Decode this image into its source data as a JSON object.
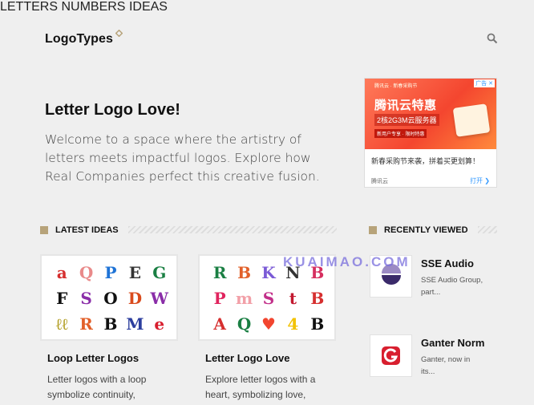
{
  "header": {
    "logo": "LogoTypes",
    "nav": [
      "LETTERS",
      "NUMBERS",
      "IDEAS"
    ],
    "icons": [
      "search-icon"
    ]
  },
  "hero": {
    "title": "Letter Logo Love!",
    "text": "Welcome to a space where the artistry of letters meets impactful logos. Explore how Real Companies perfect this creative fusion."
  },
  "ad": {
    "badge": "广告 ✕",
    "small": "腾讯云 · 新春采购节",
    "title": "腾讯云特惠",
    "subtitle": "2核2G3M云服务器",
    "tag": "新用户专享 · 限时特惠",
    "text": "新春采购节来袭，拼着买更划算！",
    "brand": "腾讯云",
    "open": "打开 ❯"
  },
  "latest": {
    "heading": "LATEST IDEAS",
    "cards": [
      {
        "title": "Loop Letter Logos",
        "desc": "Letter logos with a loop symbolize continuity,",
        "glyphs": [
          {
            "c": "a",
            "color": "#d62f2f"
          },
          {
            "c": "Q",
            "color": "#e98a8a"
          },
          {
            "c": "P",
            "color": "#1e73d6"
          },
          {
            "c": "E",
            "color": "#333"
          },
          {
            "c": "G",
            "color": "#1a7f43"
          },
          {
            "c": "F",
            "color": "#111"
          },
          {
            "c": "S",
            "color": "#8a2da8"
          },
          {
            "c": "O",
            "color": "#111"
          },
          {
            "c": "D",
            "color": "#d94a1c"
          },
          {
            "c": "W",
            "color": "#8a2da8"
          },
          {
            "c": "ℓℓ",
            "color": "#b5a22c"
          },
          {
            "c": "R",
            "color": "#e2602a"
          },
          {
            "c": "B",
            "color": "#111"
          },
          {
            "c": "M",
            "color": "#2c3e9e"
          },
          {
            "c": "e",
            "color": "#d81f2f"
          }
        ]
      },
      {
        "title": "Letter Logo Love",
        "desc": "Explore letter logos with a heart, symbolizing love,",
        "glyphs": [
          {
            "c": "R",
            "color": "#1a7f43"
          },
          {
            "c": "B",
            "color": "#e2602a"
          },
          {
            "c": "K",
            "color": "#7a5ad6"
          },
          {
            "c": "N",
            "color": "#333"
          },
          {
            "c": "B",
            "color": "#d62f5f"
          },
          {
            "c": "P",
            "color": "#e0245e"
          },
          {
            "c": "m",
            "color": "#f2a0a8"
          },
          {
            "c": "S",
            "color": "#c22f8a"
          },
          {
            "c": "t",
            "color": "#c2182f"
          },
          {
            "c": "B",
            "color": "#d62f2f"
          },
          {
            "c": "A",
            "color": "#d62f2f"
          },
          {
            "c": "Q",
            "color": "#1a7f43"
          },
          {
            "c": "♥",
            "color": "#f2452f"
          },
          {
            "c": "4",
            "color": "#f2c200"
          },
          {
            "c": "B",
            "color": "#111"
          }
        ]
      }
    ]
  },
  "recent": {
    "heading": "RECENTLY VIEWED",
    "items": [
      {
        "title": "SSE Audio",
        "desc": "SSE Audio Group, part..."
      },
      {
        "title": "Ganter Norm",
        "desc": "Ganter, now in its..."
      }
    ]
  },
  "watermark": "KUAIMAO.COM",
  "colors": {
    "background": "#efefef",
    "accent_gold": "#b7a37a",
    "ganter_red": "#d81f2f",
    "sse_purple": "#5a3e8a"
  }
}
